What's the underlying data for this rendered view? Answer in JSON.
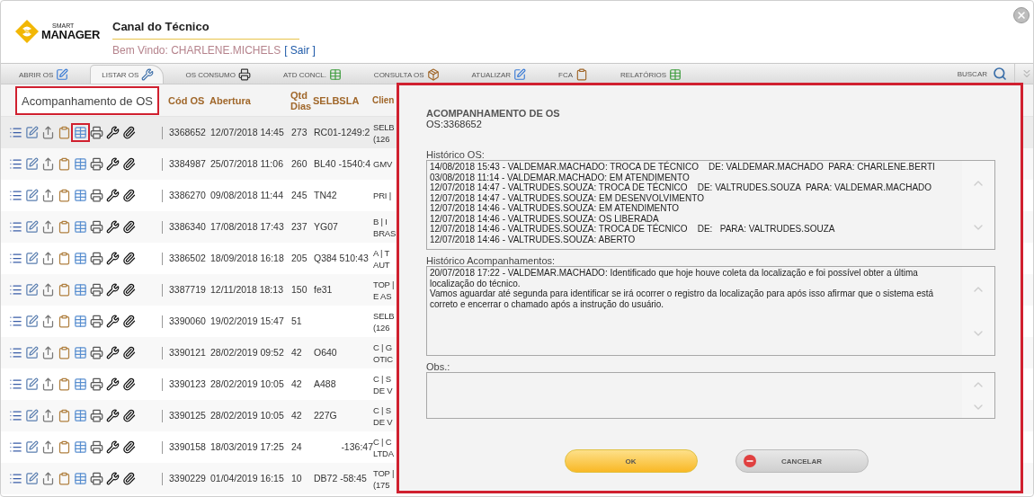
{
  "header": {
    "logo": {
      "top": "SMART",
      "bottom": "MANAGER"
    },
    "title": "Canal do Técnico",
    "welcome": "Bem Vindo: CHARLENE.MICHELS",
    "logout_link": "[ Sair ]"
  },
  "tabs": [
    {
      "label": "ABRIR OS",
      "selected": false
    },
    {
      "label": "LISTAR OS",
      "selected": true
    },
    {
      "label": "OS CONSUMO",
      "selected": false
    },
    {
      "label": "ATD CONCL.",
      "selected": false
    },
    {
      "label": "CONSULTA OS",
      "selected": false
    },
    {
      "label": "ATUALIZAR",
      "selected": false
    },
    {
      "label": "FCA",
      "selected": false
    },
    {
      "label": "RELATÓRIOS",
      "selected": false
    }
  ],
  "search": {
    "label": "BUSCAR"
  },
  "table": {
    "tooltip": "Acompanhamento de OS",
    "columns": [
      "Cód OS",
      "Abertura",
      "Qtd Dias",
      "SELBSLA",
      "Clien"
    ],
    "rows": [
      {
        "code": "3368652",
        "opened": "12/07/2018 14:45",
        "days": "273",
        "selbsla": "RC01-1249:2",
        "client": "SELB\n(126",
        "selected": true
      },
      {
        "code": "3384987",
        "opened": "25/07/2018 11:06",
        "days": "260",
        "selbsla": "BL40 -1540:4",
        "client": "GMV",
        "selected": false
      },
      {
        "code": "3386270",
        "opened": "09/08/2018 11:44",
        "days": "245",
        "selbsla": "TN42",
        "client": "PRI |",
        "selected": false
      },
      {
        "code": "3386340",
        "opened": "17/08/2018 17:43",
        "days": "237",
        "selbsla": "YG07",
        "client": "B | I\nBRAS",
        "selected": false
      },
      {
        "code": "3386502",
        "opened": "18/09/2018 16:18",
        "days": "205",
        "selbsla": "Q384 510:43",
        "client": "A | T\nAUT",
        "selected": false
      },
      {
        "code": "3387719",
        "opened": "12/11/2018 18:13",
        "days": "150",
        "selbsla": "fe31",
        "client": "TOP |\nE AS",
        "selected": false
      },
      {
        "code": "3390060",
        "opened": "19/02/2019 15:47",
        "days": "51",
        "client": "SELB\n(126",
        "selected": false
      },
      {
        "code": "3390121",
        "opened": "28/02/2019 09:52",
        "days": "42",
        "selbsla": "O640",
        "client": "C | G\nOTIC",
        "selected": false
      },
      {
        "code": "3390123",
        "opened": "28/02/2019 10:05",
        "days": "42",
        "selbsla": "A488",
        "client": "C | S\nDE V",
        "selected": false
      },
      {
        "code": "3390125",
        "opened": "28/02/2019 10:05",
        "days": "42",
        "selbsla": "227G",
        "client": "C | S\nDE V",
        "selected": false
      },
      {
        "code": "3390158",
        "opened": "18/03/2019 17:25",
        "days": "24",
        "selbsla": "-136:47",
        "client": "C | C\nLTDA",
        "selected": false
      },
      {
        "code": "3390229",
        "opened": "01/04/2019 16:15",
        "days": "10",
        "selbsla": "DB72 -58:45",
        "client": "TOP |\n(175",
        "selected": false
      }
    ]
  },
  "dialog": {
    "title": "ACOMPANHAMENTO DE OS",
    "subtitle": "OS:3368652",
    "fields": [
      {
        "label": "Histórico OS:",
        "kind": "log",
        "entries": [
          "14/08/2018 15:43 - VALDEMAR.MACHADO: TROCA DE TÉCNICO    DE: VALDEMAR.MACHADO  PARA: CHARLENE.BERTI",
          "03/08/2018 11:14 - VALDEMAR.MACHADO: EM ATENDIMENTO",
          "12/07/2018 14:47 - VALTRUDES.SOUZA: TROCA DE TÉCNICO    DE: VALTRUDES.SOUZA  PARA: VALDEMAR.MACHADO",
          "12/07/2018 14:47 - VALTRUDES.SOUZA: EM DESENVOLVIMENTO",
          "12/07/2018 14:46 - VALTRUDES.SOUZA: EM ATENDIMENTO",
          "12/07/2018 14:46 - VALTRUDES.SOUZA: OS LIBERADA",
          "12/07/2018 14:46 - VALTRUDES.SOUZA: TROCA DE TÉCNICO    DE:   PARA: VALTRUDES.SOUZA",
          "12/07/2018 14:46 - VALTRUDES.SOUZA: ABERTO"
        ]
      },
      {
        "label": "Histórico Acompanhamentos:",
        "kind": "log",
        "entries": [
          "20/07/2018 17:22 - VALDEMAR.MACHADO: Identificado que hoje houve coleta da localização e foi possível obter a última localização do técnico.",
          "Vamos aguardar até segunda para identificar se irá ocorrer o registro da localização para após isso afirmar que o sistema está correto e encerrar o chamado após a instrução do usuário."
        ]
      },
      {
        "label": "Obs.:",
        "kind": "notes"
      }
    ],
    "buttons": [
      {
        "label": "OK",
        "kind": "primary"
      },
      {
        "label": "CANCELAR",
        "kind": "cancel"
      }
    ]
  }
}
